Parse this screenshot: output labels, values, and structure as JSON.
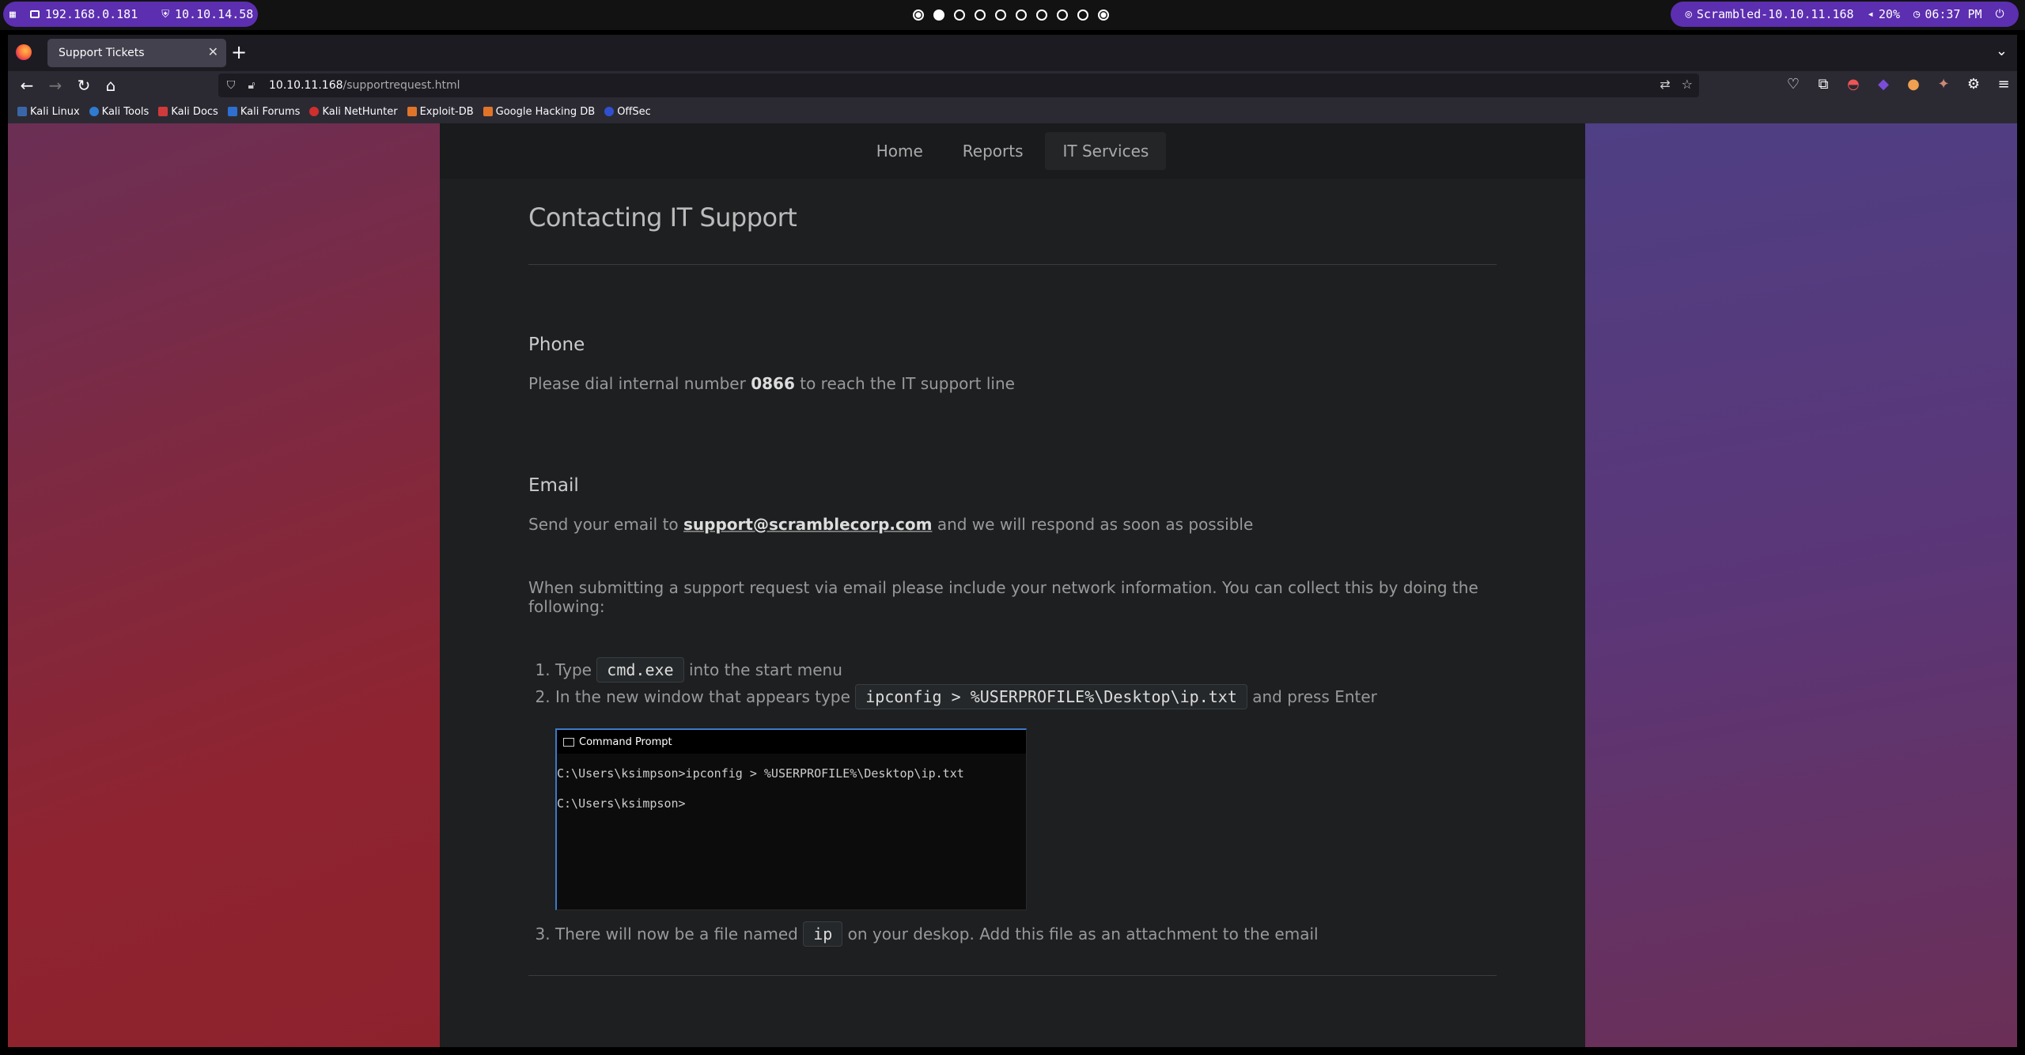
{
  "system_bar": {
    "local_ip": "192.168.0.181",
    "vpn_ip": "10.10.14.58",
    "target": "Scrambled-10.10.11.168",
    "volume": "20%",
    "time": "06:37 PM"
  },
  "browser": {
    "tab_title": "Support Tickets",
    "url_host": "10.10.11.168",
    "url_path": "/supportrequest.html",
    "bookmarks": [
      "Kali Linux",
      "Kali Tools",
      "Kali Docs",
      "Kali Forums",
      "Kali NetHunter",
      "Exploit-DB",
      "Google Hacking DB",
      "OffSec"
    ]
  },
  "page": {
    "nav": [
      "Home",
      "Reports",
      "IT Services"
    ],
    "title": "Contacting IT Support",
    "phone": {
      "heading": "Phone",
      "text_before": "Please dial internal number ",
      "number": "0866",
      "text_after": " to reach the IT support line"
    },
    "email": {
      "heading": "Email",
      "text_before": "Send your email to ",
      "address": "support@scramblecorp.com",
      "text_after": " and we will respond as soon as possible",
      "instructions": "When submitting a support request via email please include your network information. You can collect this by doing the following:"
    },
    "steps": [
      {
        "before": "Type ",
        "code": "cmd.exe",
        "after": " into the start menu"
      },
      {
        "before": "In the new window that appears type ",
        "code": "ipconfig > %USERPROFILE%\\Desktop\\ip.txt",
        "after": " and press Enter"
      },
      {
        "before": "There will now be a file named ",
        "code": "ip",
        "after": " on your deskop. Add this file as an attachment to the email"
      }
    ],
    "cmd_window": {
      "title": "Command Prompt",
      "line1": "C:\\Users\\ksimpson>ipconfig > %USERPROFILE%\\Desktop\\ip.txt",
      "line2": "C:\\Users\\ksimpson>"
    }
  }
}
